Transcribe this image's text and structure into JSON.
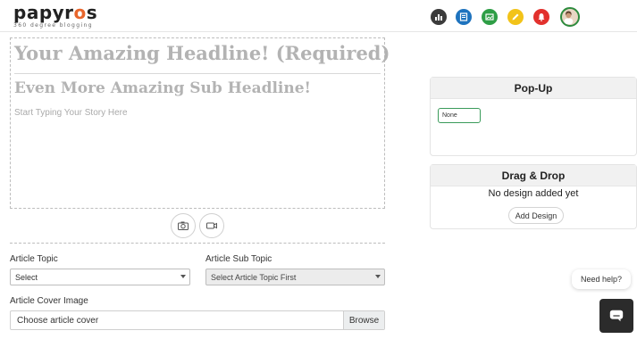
{
  "brand": {
    "name_prefix": "papyr",
    "name_o": "o",
    "name_suffix": "s",
    "tagline": "360 degree blogging",
    "accent": "#e8662c"
  },
  "header": {
    "icons": [
      {
        "name": "stats-icon",
        "color": "#3b3b3b"
      },
      {
        "name": "article-icon",
        "color": "#1e73be"
      },
      {
        "name": "gallery-icon",
        "color": "#2e9e46"
      },
      {
        "name": "edit-icon",
        "color": "#f2c319"
      },
      {
        "name": "notification-bell-icon",
        "color": "#e2312d"
      }
    ]
  },
  "editor": {
    "headline_placeholder": "Your Amazing Headline! (Required)",
    "subheadline_placeholder": "Even More Amazing Sub Headline!",
    "story_placeholder": "Start Typing Your Story Here"
  },
  "form": {
    "topic_label": "Article Topic",
    "topic_value": "Select",
    "subtopic_label": "Article Sub Topic",
    "subtopic_value": "Select Article Topic First",
    "cover_label": "Article Cover Image",
    "cover_placeholder": "Choose article cover",
    "browse_label": "Browse"
  },
  "popup_panel": {
    "title": "Pop-Up",
    "selected": "None"
  },
  "dragdrop_panel": {
    "title": "Drag & Drop",
    "empty_text": "No design added yet",
    "add_label": "Add Design"
  },
  "chat": {
    "bubble_text": "Need help?"
  }
}
